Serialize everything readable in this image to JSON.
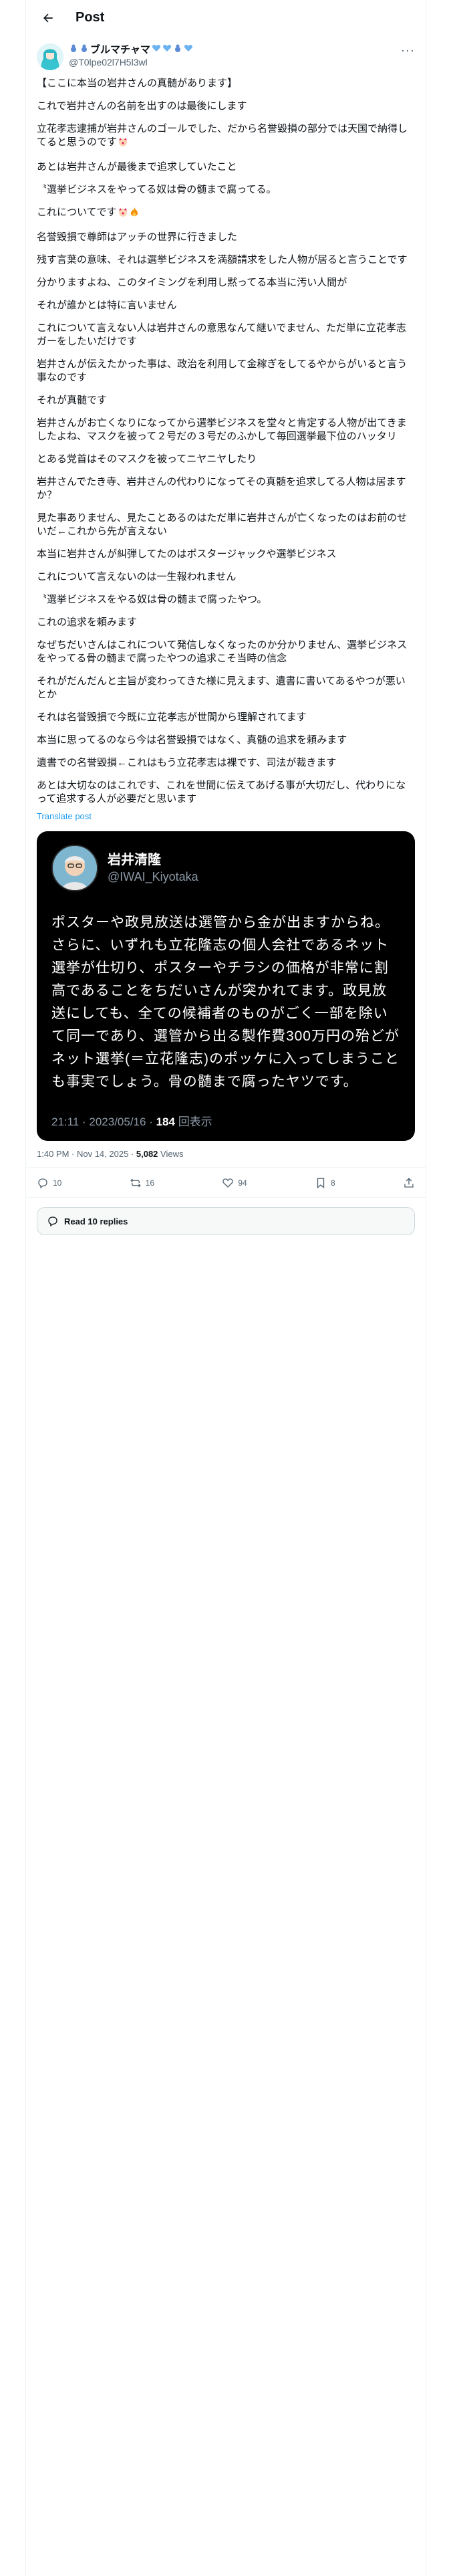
{
  "header": {
    "title": "Post"
  },
  "author": {
    "display_name": "ブルマチャマ",
    "handle": "@T0lpe02l7H5l3wl"
  },
  "post": {
    "paragraphs": [
      "【ここに本当の岩井さんの真髄があります】",
      "これで岩井さんの名前を出すのは最後にします",
      "立花孝志逮捕が岩井さんのゴールでした、だから名誉毀損の部分では天国で納得してると思うのです",
      "あとは岩井さんが最後まで追求していたこと",
      "〝選挙ビジネスをやってる奴は骨の髄まで腐ってる。",
      "これについてです",
      "名誉毀損で尊師はアッチの世界に行きました",
      "残す言葉の意味、それは選挙ビジネスを満額請求をした人物が居ると言うことです",
      "分かりますよね、このタイミングを利用し黙ってる本当に汚い人間が",
      "それが誰かとは特に言いません",
      "これについて言えない人は岩井さんの意思なんて継いでません、ただ単に立花孝志ガーをしたいだけです",
      "岩井さんが伝えたかった事は、政治を利用して金稼ぎをしてるやからがいると言う事なのです",
      "それが真髄です",
      "岩井さんがお亡くなりになってから選挙ビジネスを堂々と肯定する人物が出てきましたよね、マスクを被って２号だの３号だのふかして毎回選挙最下位のハッタリ",
      "とある党首はそのマスクを被ってニヤニヤしたり",
      "岩井さんでたき寺、岩井さんの代わりになってその真髄を追求してる人物は居ますか？",
      "見た事ありません、見たことあるのはただ単に岩井さんが亡くなったのはお前のせいだ←これから先が言えない",
      "本当に岩井さんが糾弾してたのはポスタージャックや選挙ビジネス",
      "これについて言えないのは一生報われません",
      "〝選挙ビジネスをやる奴は骨の髄まで腐ったやつ。",
      "これの追求を頼みます",
      "なぜちだいさんはこれについて発信しなくなったのか分かりません、選挙ビジネスをやってる骨の髄まで腐ったやつの追求こそ当時の信念",
      "それがだんだんと主旨が変わってきた様に見えます、遺書に書いてあるやつが悪いとか",
      "それは名誉毀損で今既に立花孝志が世間から理解されてます",
      "本当に思ってるのなら今は名誉毀損ではなく、真髄の追求を頼みます",
      "遺書での名誉毀損←これはもう立花孝志は裸です、司法が裁きます",
      "あとは大切なのはこれです、これを世間に伝えてあげる事が大切だし、代わりになって追求する人が必要だと思います"
    ],
    "translate_label": "Translate post",
    "timestamp": "1:40 PM · Nov 14, 2025",
    "views_count": "5,082",
    "views_label": "Views"
  },
  "quote": {
    "name": "岩井清隆",
    "handle": "@IWAI_Kiyotaka",
    "text": "ポスターや政見放送は選管から金が出ますからね。さらに、いずれも立花隆志の個人会社であるネット選挙が仕切り、ポスターやチラシの価格が非常に割高であることをちだいさんが突かれてます。政見放送にしても、全ての候補者のものがごく一部を除いて同一であり、選管から出る製作費300万円の殆どがネット選挙(＝立花隆志)のポッケに入ってしまうことも事実でしょう。骨の髄まで腐ったヤツです。",
    "time": "21:11 · 2023/05/16 · ",
    "views": "184",
    "views_label": "回表示"
  },
  "actions": {
    "reply_count": "10",
    "repost_count": "16",
    "like_count": "94",
    "bookmark_count": "8"
  },
  "read_replies_label": "Read 10 replies",
  "colors": {
    "accent": "#1d9bf0",
    "text": "#0f1419",
    "muted": "#536471"
  }
}
